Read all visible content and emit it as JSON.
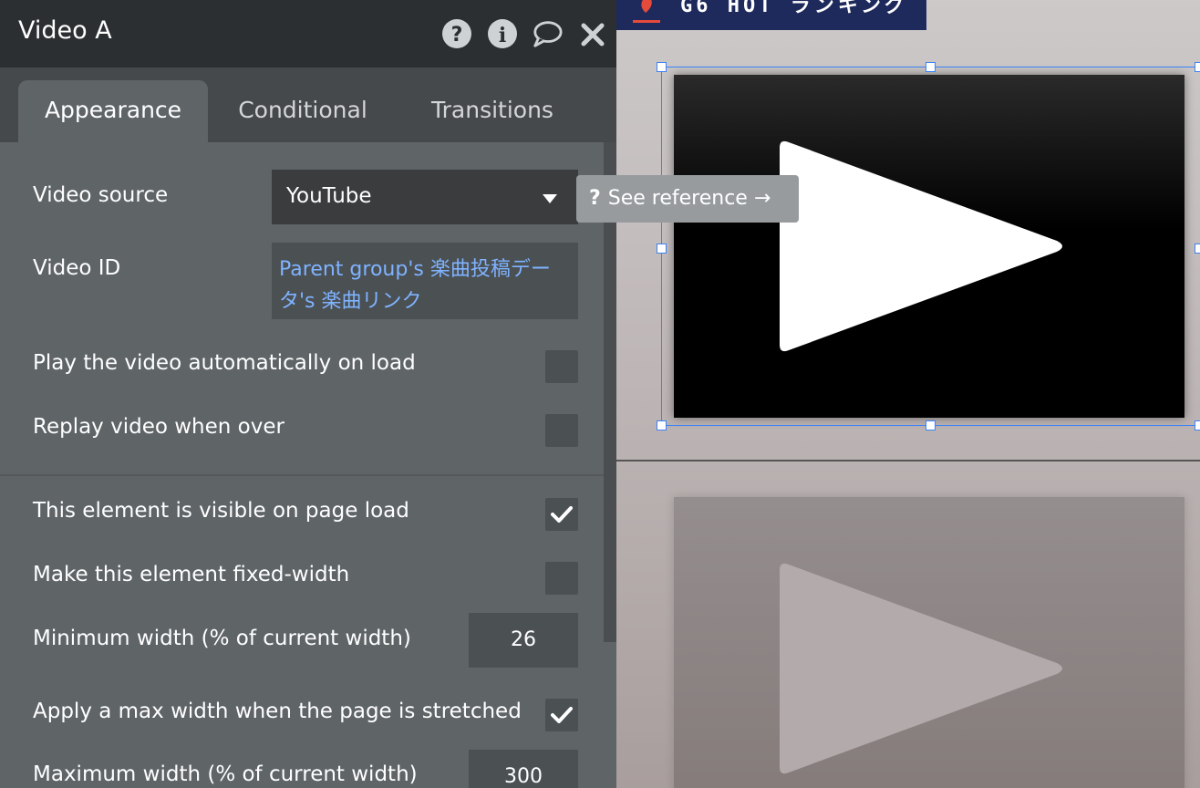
{
  "panel": {
    "title": "Video A",
    "header_icons": [
      "help-icon",
      "info-icon",
      "comment-icon",
      "close-icon"
    ]
  },
  "tabs": [
    {
      "label": "Appearance",
      "active": true
    },
    {
      "label": "Conditional",
      "active": false
    },
    {
      "label": "Transitions",
      "active": false
    }
  ],
  "fields": {
    "video_source": {
      "label": "Video source",
      "value": "YouTube"
    },
    "video_id": {
      "label": "Video ID",
      "value": "Parent group's 楽曲投稿データ's 楽曲リンク"
    },
    "autoplay": {
      "label": "Play the video automatically on load",
      "checked": false
    },
    "replay": {
      "label": "Replay video when over",
      "checked": false
    },
    "visible_on_load": {
      "label": "This element is visible on page load",
      "checked": true
    },
    "fixed_width": {
      "label": "Make this element fixed-width",
      "checked": false
    },
    "min_width": {
      "label": "Minimum width (% of current width)",
      "value": "26"
    },
    "apply_max_width": {
      "label": "Apply a max width when the page is stretched",
      "checked": true
    },
    "max_width": {
      "label": "Maximum width (% of current width)",
      "value": "300"
    }
  },
  "tooltip": {
    "icon": "?",
    "text": "See reference →"
  },
  "canvas": {
    "banner_text": "G6 HOT ランキング",
    "colors": {
      "banner": "#1e2a5c",
      "selection": "#3b82f6",
      "link_text": "#7fb3ff"
    }
  }
}
